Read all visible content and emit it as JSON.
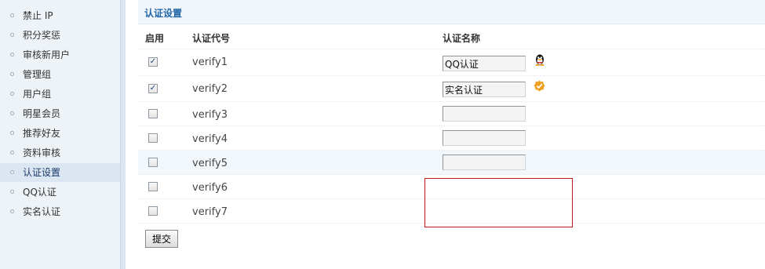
{
  "sidebar": {
    "items": [
      {
        "label": "禁止 IP",
        "active": false
      },
      {
        "label": "积分奖惩",
        "active": false
      },
      {
        "label": "审核新用户",
        "active": false
      },
      {
        "label": "管理组",
        "active": false
      },
      {
        "label": "用户组",
        "active": false
      },
      {
        "label": "明星会员",
        "active": false
      },
      {
        "label": "推荐好友",
        "active": false
      },
      {
        "label": "资料审核",
        "active": false
      },
      {
        "label": "认证设置",
        "active": true
      },
      {
        "label": "QQ认证",
        "active": false
      },
      {
        "label": "实名认证",
        "active": false
      }
    ]
  },
  "section": {
    "title": "认证设置"
  },
  "table": {
    "headers": {
      "enable": "启用",
      "code": "认证代号",
      "name": "认证名称"
    },
    "rows": [
      {
        "checked": true,
        "code": "verify1",
        "name": "QQ认证",
        "icon": "qq-penguin-icon"
      },
      {
        "checked": true,
        "code": "verify2",
        "name": "实名认证",
        "icon": "verified-badge-icon"
      },
      {
        "checked": false,
        "code": "verify3",
        "name": "",
        "icon": ""
      },
      {
        "checked": false,
        "code": "verify4",
        "name": "",
        "icon": ""
      },
      {
        "checked": false,
        "code": "verify5",
        "name": "",
        "icon": ""
      },
      {
        "checked": false,
        "code": "verify6",
        "name": "",
        "icon": ""
      },
      {
        "checked": false,
        "code": "verify7",
        "name": "",
        "icon": ""
      }
    ]
  },
  "submit": {
    "label": "提交"
  },
  "colors": {
    "title": "#2366a8",
    "sidebar_bg": "#eef3f8",
    "highlight_box": "#c41616"
  }
}
